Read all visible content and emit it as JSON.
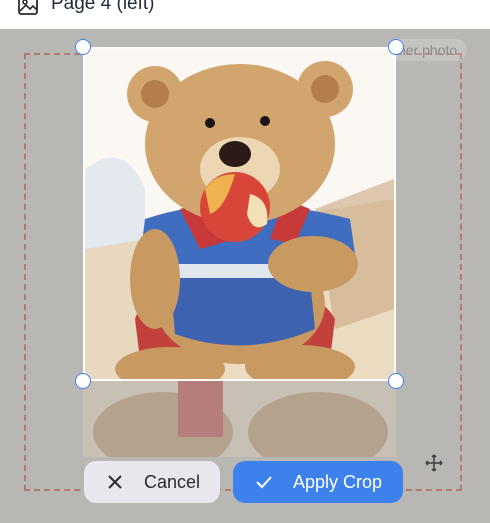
{
  "header": {
    "title": "Page 4 (left)"
  },
  "canvas": {
    "other_photo_label": "her photo"
  },
  "actions": {
    "cancel_label": "Cancel",
    "apply_label": "Apply Crop"
  },
  "colors": {
    "accent": "#3d82ec",
    "overlay": "#b9b7b4",
    "bleed_guide": "#b07a7a",
    "cancel_bg": "#e9e7ee"
  },
  "icons": {
    "header": "image-icon",
    "cancel": "close-icon",
    "apply": "check-icon",
    "move": "move-icon"
  }
}
